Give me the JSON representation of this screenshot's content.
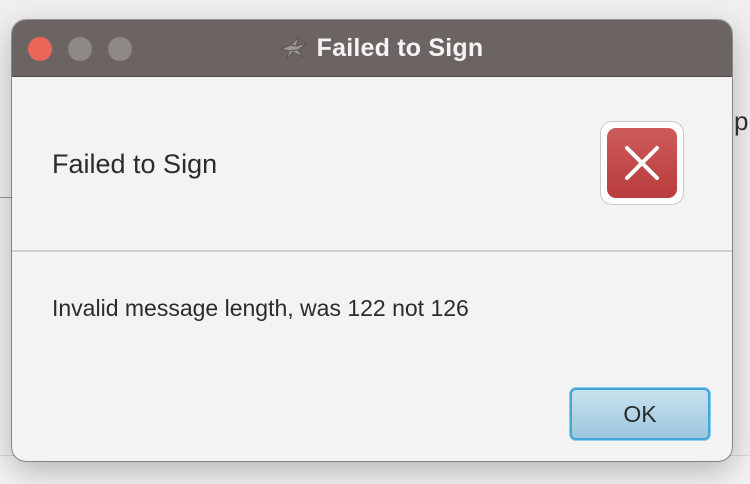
{
  "window": {
    "title": "Failed to Sign",
    "titlebar_color": "#6b6462",
    "traffic_lights": {
      "close_color": "#ec6559",
      "inactive_color": "#8e8886"
    }
  },
  "background": {
    "partial_text": "p"
  },
  "dialog": {
    "header": "Failed to Sign",
    "icon": "error-x-icon",
    "icon_color": "#c44a4a",
    "message": "Invalid message length, was 122 not 126",
    "buttons": {
      "ok_label": "OK"
    },
    "accent_color": "#3ea6d8"
  }
}
